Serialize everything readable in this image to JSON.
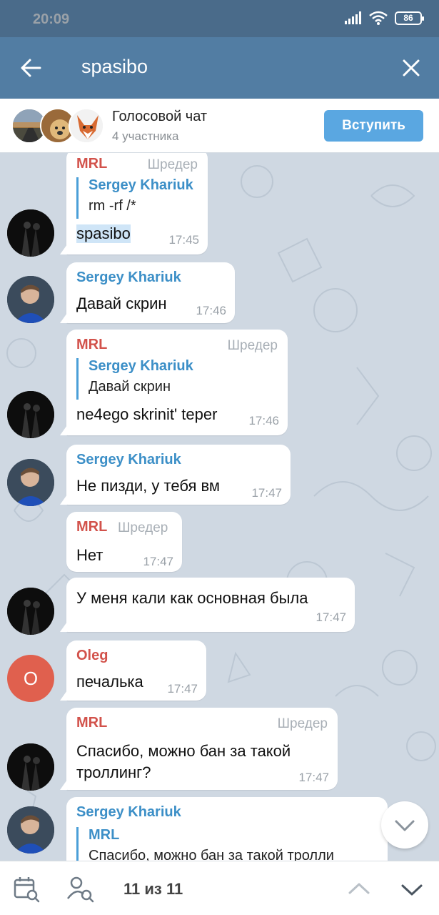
{
  "status_bar": {
    "time": "20:09",
    "battery": "86",
    "icons": [
      "signal-icon",
      "wifi-icon",
      "battery-icon"
    ]
  },
  "search": {
    "query": "spasibo",
    "back_icon": "back-arrow-icon",
    "close_icon": "close-icon"
  },
  "voice_chat": {
    "title": "Голосовой чат",
    "subtitle": "4 участника",
    "join_label": "Вступить"
  },
  "messages": [
    {
      "sender": "MRL",
      "role": "Шредер",
      "reply_name": "Sergey Khariuk",
      "reply_text": "rm -rf /*",
      "text": "spasibo",
      "time": "17:45"
    },
    {
      "sender": "Sergey Khariuk",
      "text": "Давай скрин",
      "time": "17:46"
    },
    {
      "sender": "MRL",
      "role": "Шредер",
      "reply_name": "Sergey Khariuk",
      "reply_text": "Давай скрин",
      "text": "ne4ego skrinit' teper",
      "time": "17:46"
    },
    {
      "sender": "Sergey Khariuk",
      "text": "Не пизди, у тебя вм",
      "time": "17:47"
    },
    {
      "sender": "MRL",
      "role": "Шредер",
      "text": "Нет",
      "time": "17:47"
    },
    {
      "text": "У меня кали как основная была",
      "time": "17:47"
    },
    {
      "sender": "Oleg",
      "avatar_letter": "O",
      "text": "печалька",
      "time": "17:47"
    },
    {
      "sender": "MRL",
      "role": "Шредер",
      "text_line1": "Спасибо, можно бан за такой",
      "text_line2": "троллинг?",
      "time": "17:47"
    },
    {
      "sender": "Sergey Khariuk",
      "reply_name": "MRL",
      "reply_text": "Спасибо, можно бан за такой тролли"
    }
  ],
  "bottom_bar": {
    "counter": "11 из 11",
    "icons": [
      "calendar-search-icon",
      "user-search-icon",
      "chevron-up-icon",
      "chevron-down-icon"
    ]
  },
  "colors": {
    "status_bar": "#4a6b8a",
    "search_bar": "#527da3",
    "join_button": "#5aa7e1",
    "mrl_name": "#d2524b",
    "sergey_name": "#3c8fc7",
    "chat_background": "#cfd8e2",
    "oleg_avatar": "#e0604e"
  }
}
